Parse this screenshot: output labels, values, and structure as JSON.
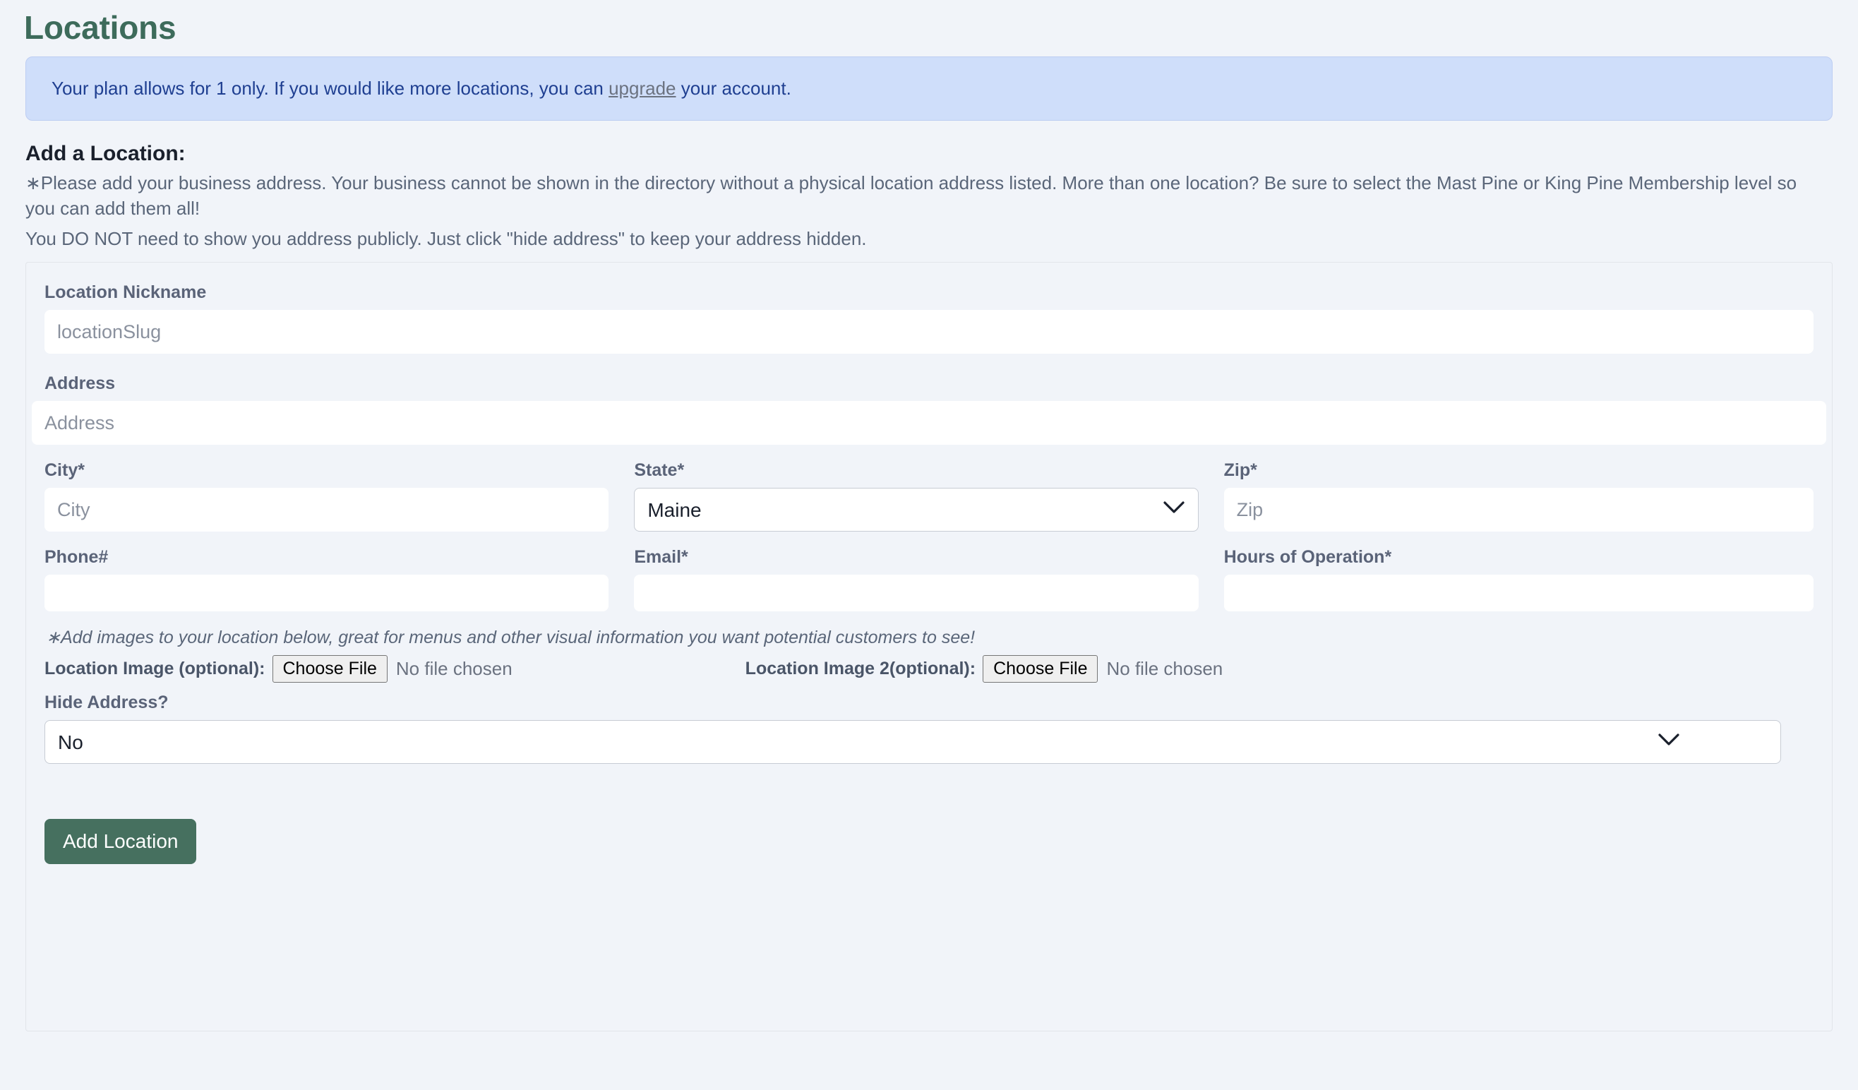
{
  "page": {
    "title": "Locations"
  },
  "alert": {
    "before_link": "Your plan allows for 1 only. If you would like more locations, you can ",
    "link_text": "upgrade",
    "after_link": " your account.",
    "bg_color": "#cfdefa",
    "text_color": "#1f3f91"
  },
  "intro": {
    "heading": "Add a Location:",
    "line1": "∗Please add your business address. Your business cannot be shown in the directory without a physical location address listed. More than one location? Be sure to select the Mast Pine or King Pine Membership level so you can add them all!",
    "line2": "You DO NOT need to show you address publicly. Just click \"hide address\" to keep your address hidden."
  },
  "form": {
    "nickname": {
      "label": "Location Nickname",
      "placeholder": "locationSlug",
      "value": ""
    },
    "address": {
      "label": "Address",
      "placeholder": "Address",
      "value": ""
    },
    "city": {
      "label": "City*",
      "placeholder": "City",
      "value": ""
    },
    "state": {
      "label": "State*",
      "selected": "Maine",
      "icon": "chevron-down-icon"
    },
    "zip": {
      "label": "Zip*",
      "placeholder": "Zip",
      "value": ""
    },
    "phone": {
      "label": "Phone#",
      "placeholder": "",
      "value": ""
    },
    "email": {
      "label": "Email*",
      "placeholder": "",
      "value": ""
    },
    "hours": {
      "label": "Hours of Operation*",
      "placeholder": "",
      "value": ""
    },
    "images_note": "∗Add images to your location below, great for menus and other visual information you want potential customers to see!",
    "image1": {
      "label": "Location Image (optional):",
      "button": "Choose File",
      "status": "No file chosen"
    },
    "image2": {
      "label": "Location Image 2(optional):",
      "button": "Choose File",
      "status": "No file chosen"
    },
    "hide_address": {
      "label": "Hide Address?",
      "selected": "No",
      "icon": "chevron-down-icon"
    },
    "submit": {
      "label": "Add Location",
      "color": "#46705f"
    }
  }
}
